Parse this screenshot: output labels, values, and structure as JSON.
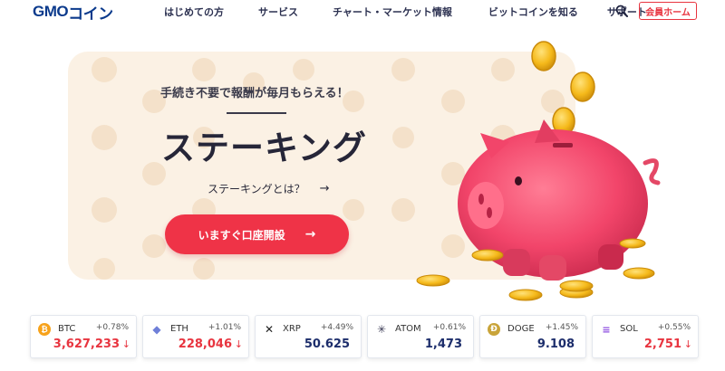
{
  "header": {
    "logo_gmo": "GMO",
    "logo_coin": "コイン",
    "nav": [
      "はじめての方",
      "サービス",
      "チャート・マーケット情報",
      "ビットコインを知る",
      "サポート"
    ],
    "member_button": "会員ホーム"
  },
  "hero": {
    "tagline": "手続き不要で報酬が毎月もらえる！",
    "title": "ステーキング",
    "what_is_link": "ステーキングとは？",
    "cta_label": "いますぐ口座開設",
    "arrow": "→"
  },
  "tickers": [
    {
      "symbol": "BTC",
      "change": "+0.78%",
      "price": "3,627,233",
      "price_color": "red",
      "direction": "down",
      "icon_color": "#f7a21b",
      "icon": "bitcoin-icon"
    },
    {
      "symbol": "ETH",
      "change": "+1.01%",
      "price": "228,046",
      "price_color": "red",
      "direction": "down",
      "icon_color": "#6f7fd8",
      "icon": "ethereum-icon"
    },
    {
      "symbol": "XRP",
      "change": "+4.49%",
      "price": "50.625",
      "price_color": "blue",
      "direction": "none",
      "icon_color": "#222222",
      "icon": "xrp-icon"
    },
    {
      "symbol": "ATOM",
      "change": "+0.61%",
      "price": "1,473",
      "price_color": "blue",
      "direction": "none",
      "icon_color": "#3b3b55",
      "icon": "cosmos-icon"
    },
    {
      "symbol": "DOGE",
      "change": "+1.45%",
      "price": "9.108",
      "price_color": "blue",
      "direction": "none",
      "icon_color": "#c9a43a",
      "icon": "dogecoin-icon"
    },
    {
      "symbol": "SOL",
      "change": "+0.55%",
      "price": "2,751",
      "price_color": "red",
      "direction": "down",
      "icon_color": "#8e4fe0",
      "icon": "solana-icon"
    }
  ],
  "colors": {
    "brand_blue": "#0b3a8c",
    "accent_red": "#ef3347",
    "hero_bg": "#fbf1e4"
  }
}
